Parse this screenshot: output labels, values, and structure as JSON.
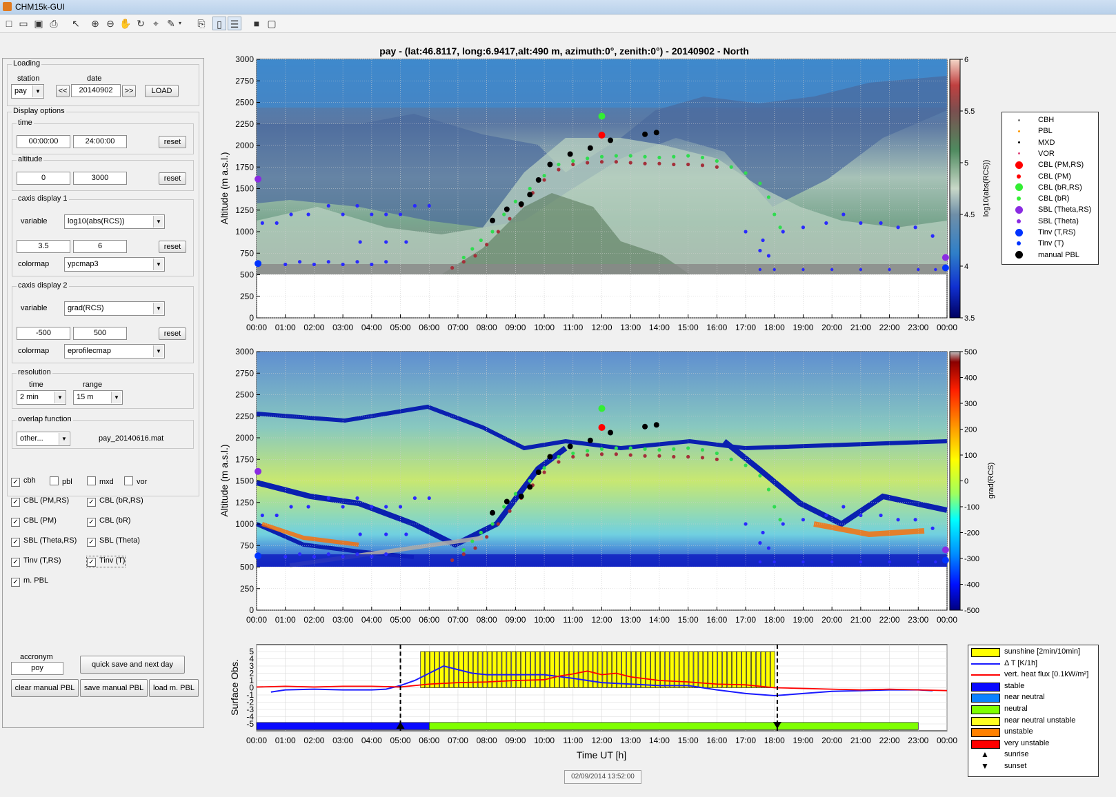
{
  "window": {
    "title": "CHM15k-GUI"
  },
  "toolbar": {
    "icons": [
      "new-file-icon",
      "open-folder-icon",
      "save-icon",
      "print-icon",
      "pointer-icon",
      "zoom-in-icon",
      "zoom-out-icon",
      "pan-hand-icon",
      "rotate-icon",
      "data-cursor-icon",
      "brush-icon",
      "link-plot-icon",
      "colorbar-toggle-icon",
      "legend-toggle-icon",
      "hide-tools-icon",
      "dock-icon"
    ]
  },
  "loading": {
    "caption": "Loading",
    "station_label": "station",
    "date_label": "date",
    "station_value": "pay",
    "date_value": "20140902",
    "prev_label": "<<",
    "next_label": ">>",
    "load_label": "LOAD"
  },
  "display": {
    "caption": "Display options",
    "time": {
      "caption": "time",
      "from": "00:00:00",
      "to": "24:00:00",
      "reset": "reset"
    },
    "altitude": {
      "caption": "altitude",
      "from": "0",
      "to": "3000",
      "reset": "reset"
    },
    "caxis1": {
      "caption": "caxis display 1",
      "variable_label": "variable",
      "variable": "log10(abs(RCS))",
      "min": "3.5",
      "max": "6",
      "reset": "reset",
      "colormap_label": "colormap",
      "colormap": "ypcmap3"
    },
    "caxis2": {
      "caption": "caxis display 2",
      "variable_label": "variable",
      "variable": "grad(RCS)",
      "min": "-500",
      "max": "500",
      "reset": "reset",
      "colormap_label": "colormap",
      "colormap": "eprofilecmap"
    },
    "resolution": {
      "caption": "resolution",
      "time_label": "time",
      "range_label": "range",
      "time": "2 min",
      "range": "15 m"
    },
    "overlap": {
      "caption": "overlap function",
      "selected": "other...",
      "file": "pay_20140616.mat"
    }
  },
  "checkboxes": [
    {
      "label": "cbh",
      "checked": true
    },
    {
      "label": "pbl",
      "checked": false
    },
    {
      "label": "mxd",
      "checked": false
    },
    {
      "label": "vor",
      "checked": false
    },
    {
      "label": "CBL (PM,RS)",
      "checked": true
    },
    {
      "label": "CBL (bR,RS)",
      "checked": true
    },
    {
      "label": "CBL (PM)",
      "checked": true
    },
    {
      "label": "CBL (bR)",
      "checked": true
    },
    {
      "label": "SBL (Theta,RS)",
      "checked": true
    },
    {
      "label": "SBL (Theta)",
      "checked": true
    },
    {
      "label": "Tinv (T,RS)",
      "checked": true
    },
    {
      "label": "Tinv (T)",
      "checked": true
    },
    {
      "label": "m. PBL",
      "checked": true
    }
  ],
  "footer": {
    "acronym_label": "accronym",
    "acronym_value": "poy",
    "quick_save": "quick save and next day",
    "clear_manual": "clear manual PBL",
    "save_manual": "save manual PBL",
    "load_manual": "load m. PBL"
  },
  "plot1": {
    "title": "pay - (lat:46.8117, long:6.9417,alt:490 m, azimuth:0°, zenith:0°) - 20140902 - North",
    "ylabel": "Altitude (m a.s.l.)",
    "colorbar_label": "log10(abs(RCS))",
    "colorbar_ticks": [
      "6",
      "5.5",
      "5",
      "4.5",
      "4",
      "3.5"
    ]
  },
  "plot2": {
    "ylabel": "Altitude (m a.s.l.)",
    "colorbar_label": "grad(RCS)",
    "colorbar_ticks": [
      "500",
      "400",
      "300",
      "200",
      "100",
      "0",
      "-100",
      "-200",
      "-300",
      "-400",
      "-500"
    ]
  },
  "axes": {
    "yticks": [
      "3000",
      "2750",
      "2500",
      "2250",
      "2000",
      "1750",
      "1500",
      "1250",
      "1000",
      "750",
      "500",
      "250",
      "0"
    ],
    "xticks": [
      "00:00",
      "01:00",
      "02:00",
      "03:00",
      "04:00",
      "05:00",
      "06:00",
      "07:00",
      "08:00",
      "09:00",
      "10:00",
      "11:00",
      "12:00",
      "13:00",
      "14:00",
      "15:00",
      "16:00",
      "17:00",
      "18:00",
      "19:00",
      "20:00",
      "21:00",
      "22:00",
      "23:00",
      "00:00"
    ]
  },
  "plot3": {
    "ylabel": "Surface Obs.",
    "xlabel": "Time UT [h]",
    "yticks": [
      "5",
      "4",
      "3",
      "2",
      "1",
      "0",
      "-1",
      "-2",
      "-3",
      "-4",
      "-5"
    ]
  },
  "legend1": [
    {
      "label": "CBH",
      "color": "#777777",
      "marker": "dot"
    },
    {
      "label": "PBL",
      "color": "#ff9900",
      "marker": "dot"
    },
    {
      "label": "MXD",
      "color": "#000000",
      "marker": "dot"
    },
    {
      "label": "VOR",
      "color": "#e0457b",
      "marker": "dot"
    },
    {
      "label": "CBL (PM,RS)",
      "color": "#ff0000",
      "marker": "big"
    },
    {
      "label": "CBL (PM)",
      "color": "#ff0000",
      "marker": "small"
    },
    {
      "label": "CBL (bR,RS)",
      "color": "#33ee33",
      "marker": "big"
    },
    {
      "label": "CBL (bR)",
      "color": "#33ee33",
      "marker": "small"
    },
    {
      "label": "SBL (Theta,RS)",
      "color": "#8a2be2",
      "marker": "big"
    },
    {
      "label": "SBL (Theta)",
      "color": "#8a2be2",
      "marker": "small"
    },
    {
      "label": "Tinv (T,RS)",
      "color": "#0033ff",
      "marker": "big"
    },
    {
      "label": "Tinv (T)",
      "color": "#0033ff",
      "marker": "small"
    },
    {
      "label": "manual PBL",
      "color": "#000000",
      "marker": "big"
    }
  ],
  "legend3": [
    {
      "label": "sunshine [2min/10min]",
      "kind": "rect",
      "color": "#ffff00"
    },
    {
      "label": "Δ T [K/1h]",
      "kind": "line",
      "color": "#1a1aff"
    },
    {
      "label": "vert. heat flux [0.1kW/m²]",
      "kind": "line",
      "color": "#ff0000"
    },
    {
      "label": "stable",
      "kind": "rect",
      "color": "#0a0aff"
    },
    {
      "label": "near neutral",
      "kind": "rect",
      "color": "#0a82ff"
    },
    {
      "label": "neutral",
      "kind": "rect",
      "color": "#7fff00"
    },
    {
      "label": "near neutral unstable",
      "kind": "rect",
      "color": "#ffff22"
    },
    {
      "label": "unstable",
      "kind": "rect",
      "color": "#ff8000"
    },
    {
      "label": "very unstable",
      "kind": "rect",
      "color": "#ff0000"
    },
    {
      "label": "sunrise",
      "kind": "tri-up",
      "color": "#000000"
    },
    {
      "label": "sunset",
      "kind": "tri-down",
      "color": "#000000"
    }
  ],
  "timestamp": "02/09/2014 13:52:00",
  "series": {
    "cbl_bR": [
      [
        7.2,
        700
      ],
      [
        7.5,
        800
      ],
      [
        7.8,
        900
      ],
      [
        8.2,
        1000
      ],
      [
        8.6,
        1200
      ],
      [
        9.0,
        1350
      ],
      [
        9.5,
        1500
      ],
      [
        10.0,
        1650
      ],
      [
        10.5,
        1780
      ],
      [
        11.0,
        1820
      ],
      [
        11.5,
        1850
      ],
      [
        12.0,
        1870
      ],
      [
        12.5,
        1880
      ],
      [
        13.0,
        1880
      ],
      [
        13.5,
        1870
      ],
      [
        14.0,
        1860
      ],
      [
        14.5,
        1870
      ],
      [
        15.0,
        1880
      ],
      [
        15.5,
        1860
      ],
      [
        16.0,
        1820
      ],
      [
        16.5,
        1750
      ],
      [
        17.0,
        1680
      ],
      [
        17.5,
        1560
      ],
      [
        17.8,
        1400
      ],
      [
        18.0,
        1200
      ],
      [
        18.2,
        1050
      ]
    ],
    "cbl_PM": [
      [
        6.8,
        580
      ],
      [
        7.2,
        650
      ],
      [
        7.6,
        720
      ],
      [
        8.0,
        850
      ],
      [
        8.4,
        1000
      ],
      [
        8.8,
        1150
      ],
      [
        9.2,
        1300
      ],
      [
        9.6,
        1450
      ],
      [
        10.0,
        1600
      ],
      [
        10.5,
        1720
      ],
      [
        11.0,
        1780
      ],
      [
        11.5,
        1800
      ],
      [
        12.0,
        1810
      ],
      [
        12.5,
        1810
      ],
      [
        13.0,
        1800
      ],
      [
        13.5,
        1790
      ],
      [
        14.0,
        1790
      ],
      [
        14.5,
        1780
      ],
      [
        15.0,
        1780
      ],
      [
        15.5,
        1770
      ],
      [
        16.0,
        1750
      ]
    ],
    "manual": [
      [
        8.2,
        1130
      ],
      [
        8.7,
        1260
      ],
      [
        9.2,
        1320
      ],
      [
        9.5,
        1430
      ],
      [
        9.8,
        1600
      ],
      [
        10.2,
        1780
      ],
      [
        10.9,
        1900
      ],
      [
        11.6,
        1970
      ],
      [
        12.3,
        2060
      ],
      [
        13.5,
        2130
      ],
      [
        13.9,
        2150
      ]
    ],
    "tinv": [
      [
        0.2,
        1100
      ],
      [
        0.7,
        1100
      ],
      [
        1.2,
        1200
      ],
      [
        1.8,
        1200
      ],
      [
        2.5,
        1300
      ],
      [
        3.0,
        1200
      ],
      [
        3.5,
        1300
      ],
      [
        4.0,
        1200
      ],
      [
        4.5,
        1200
      ],
      [
        5.0,
        1200
      ],
      [
        5.5,
        1300
      ],
      [
        6.0,
        1300
      ],
      [
        3.6,
        880
      ],
      [
        4.5,
        880
      ],
      [
        5.2,
        880
      ],
      [
        1.5,
        650
      ],
      [
        2.5,
        650
      ],
      [
        3.5,
        650
      ],
      [
        4.5,
        650
      ],
      [
        17.0,
        1000
      ],
      [
        17.6,
        900
      ],
      [
        18.3,
        1000
      ],
      [
        19.0,
        1050
      ],
      [
        19.8,
        1100
      ],
      [
        20.4,
        1200
      ],
      [
        21.0,
        1100
      ],
      [
        21.7,
        1100
      ],
      [
        22.3,
        1050
      ],
      [
        22.9,
        1050
      ],
      [
        23.5,
        950
      ],
      [
        17.5,
        780
      ],
      [
        17.8,
        720
      ],
      [
        1.0,
        620
      ],
      [
        2.0,
        620
      ],
      [
        3.0,
        620
      ],
      [
        4.0,
        620
      ]
    ],
    "tinv_surface": [
      [
        17.5,
        560
      ],
      [
        18.0,
        560
      ],
      [
        19.0,
        560
      ],
      [
        20.0,
        560
      ],
      [
        21.0,
        560
      ],
      [
        22.0,
        560
      ],
      [
        23.0,
        560
      ],
      [
        23.6,
        560
      ]
    ],
    "big_points": [
      {
        "x": 0.05,
        "y": 1610,
        "c": "#8a2be2"
      },
      {
        "x": 0.05,
        "y": 630,
        "c": "#0033ff"
      },
      {
        "x": 12.0,
        "y": 2340,
        "c": "#33ee33"
      },
      {
        "x": 12.0,
        "y": 2120,
        "c": "#ff0000"
      },
      {
        "x": 23.95,
        "y": 580,
        "c": "#0033ff"
      },
      {
        "x": 23.95,
        "y": 700,
        "c": "#8a2be2"
      }
    ]
  },
  "surface": {
    "sunshine_start": 5.7,
    "sunshine_end": 17.9,
    "sunrise": 5.0,
    "sunset": 18.1,
    "dT": [
      [
        0.5,
        -0.6
      ],
      [
        1,
        -0.3
      ],
      [
        2,
        -0.2
      ],
      [
        3,
        -0.3
      ],
      [
        4,
        -0.3
      ],
      [
        4.5,
        -0.2
      ],
      [
        5,
        0.3
      ],
      [
        5.5,
        1.0
      ],
      [
        6,
        2.0
      ],
      [
        6.5,
        3.0
      ],
      [
        7,
        2.5
      ],
      [
        7.5,
        2.0
      ],
      [
        8,
        1.8
      ],
      [
        9,
        1.8
      ],
      [
        10,
        1.8
      ],
      [
        11,
        1.3
      ],
      [
        12,
        0.7
      ],
      [
        13,
        0.5
      ],
      [
        14,
        0.3
      ],
      [
        15,
        0.3
      ],
      [
        16,
        -0.3
      ],
      [
        17,
        -0.8
      ],
      [
        18,
        -1.1
      ],
      [
        19,
        -0.8
      ],
      [
        20,
        -0.5
      ],
      [
        21,
        -0.4
      ],
      [
        22,
        -0.3
      ],
      [
        23,
        -0.3
      ],
      [
        23.5,
        -0.4
      ]
    ],
    "flux": [
      [
        0,
        0.1
      ],
      [
        1,
        0.2
      ],
      [
        2,
        0.1
      ],
      [
        3,
        0.2
      ],
      [
        4,
        0.2
      ],
      [
        5,
        0.1
      ],
      [
        6,
        0.5
      ],
      [
        7,
        0.7
      ],
      [
        8,
        0.8
      ],
      [
        9,
        1.0
      ],
      [
        10,
        1.1
      ],
      [
        10.5,
        1.6
      ],
      [
        11,
        1.9
      ],
      [
        11.5,
        2.3
      ],
      [
        12,
        1.8
      ],
      [
        12.5,
        2.0
      ],
      [
        13,
        1.5
      ],
      [
        14,
        1.0
      ],
      [
        15,
        0.8
      ],
      [
        16,
        0.5
      ],
      [
        17,
        0.4
      ],
      [
        18,
        0.0
      ],
      [
        19,
        -0.1
      ],
      [
        20,
        -0.2
      ],
      [
        21,
        -0.3
      ],
      [
        22,
        -0.2
      ],
      [
        23,
        -0.3
      ],
      [
        24,
        -0.4
      ]
    ],
    "stability": [
      {
        "from": 0,
        "to": 6,
        "color": "#0a0aff"
      },
      {
        "from": 6,
        "to": 23,
        "color": "#7fff00"
      }
    ]
  }
}
